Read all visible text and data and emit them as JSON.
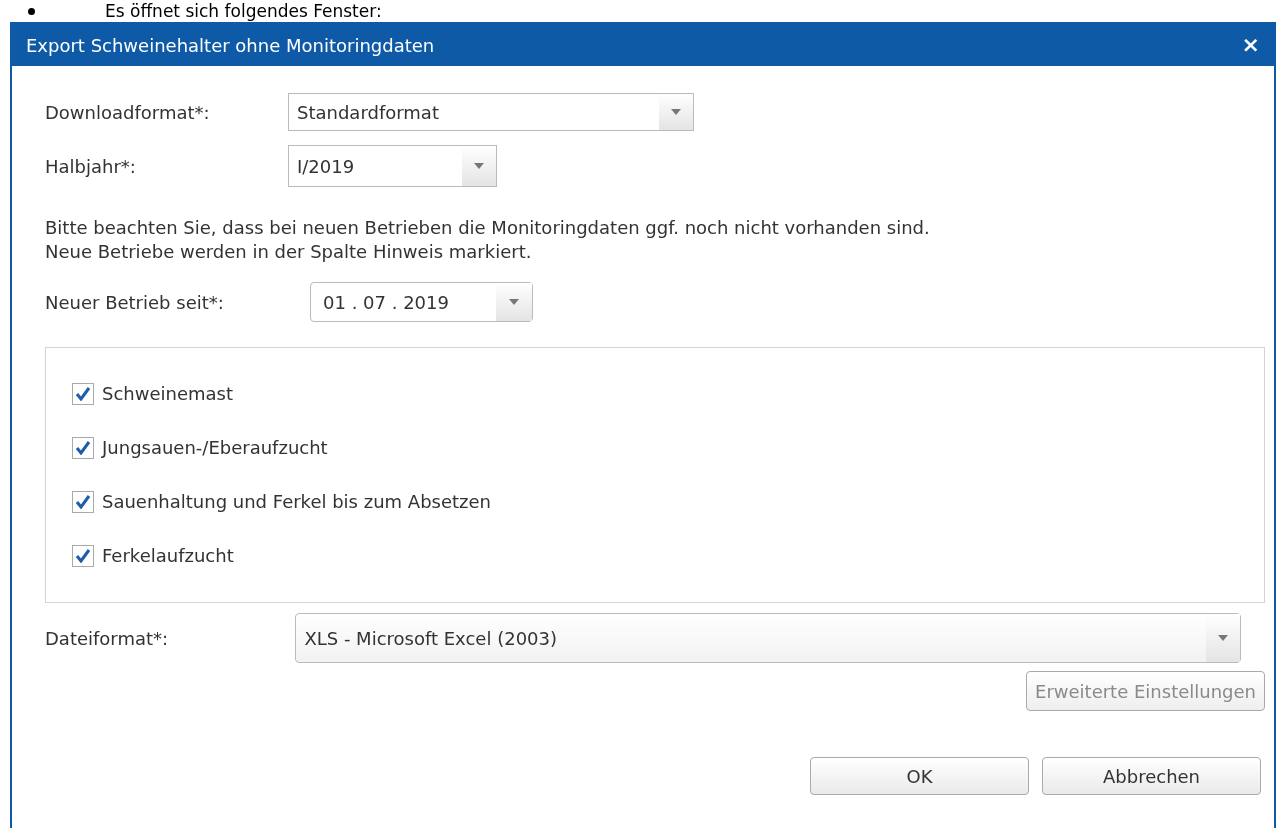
{
  "intro": "Es öffnet sich folgendes Fenster:",
  "window": {
    "title": "Export Schweinehalter ohne Monitoringdaten",
    "close": "×"
  },
  "download_format": {
    "label": "Downloadformat*:",
    "value": "Standardformat"
  },
  "half_year": {
    "label": "Halbjahr*:",
    "value": "I/2019"
  },
  "note": "Bitte beachten Sie, dass bei neuen Betrieben die Monitoringdaten ggf. noch nicht vorhanden sind. Neue Betriebe werden in der Spalte Hinweis markiert.",
  "new_since": {
    "label": "Neuer Betrieb seit*:",
    "value": "01 . 07 . 2019"
  },
  "categories": [
    {
      "label": "Schweinemast",
      "checked": true
    },
    {
      "label": "Jungsauen-/Eberaufzucht",
      "checked": true
    },
    {
      "label": "Sauenhaltung und Ferkel bis zum Absetzen",
      "checked": true
    },
    {
      "label": "Ferkelaufzucht",
      "checked": true
    }
  ],
  "file_format": {
    "label": "Dateiformat*:",
    "value": "XLS - Microsoft Excel (2003)"
  },
  "advanced_button": {
    "label": "Erweiterte Einstellungen",
    "disabled": true
  },
  "buttons": [
    "OK",
    "Abbrechen"
  ]
}
